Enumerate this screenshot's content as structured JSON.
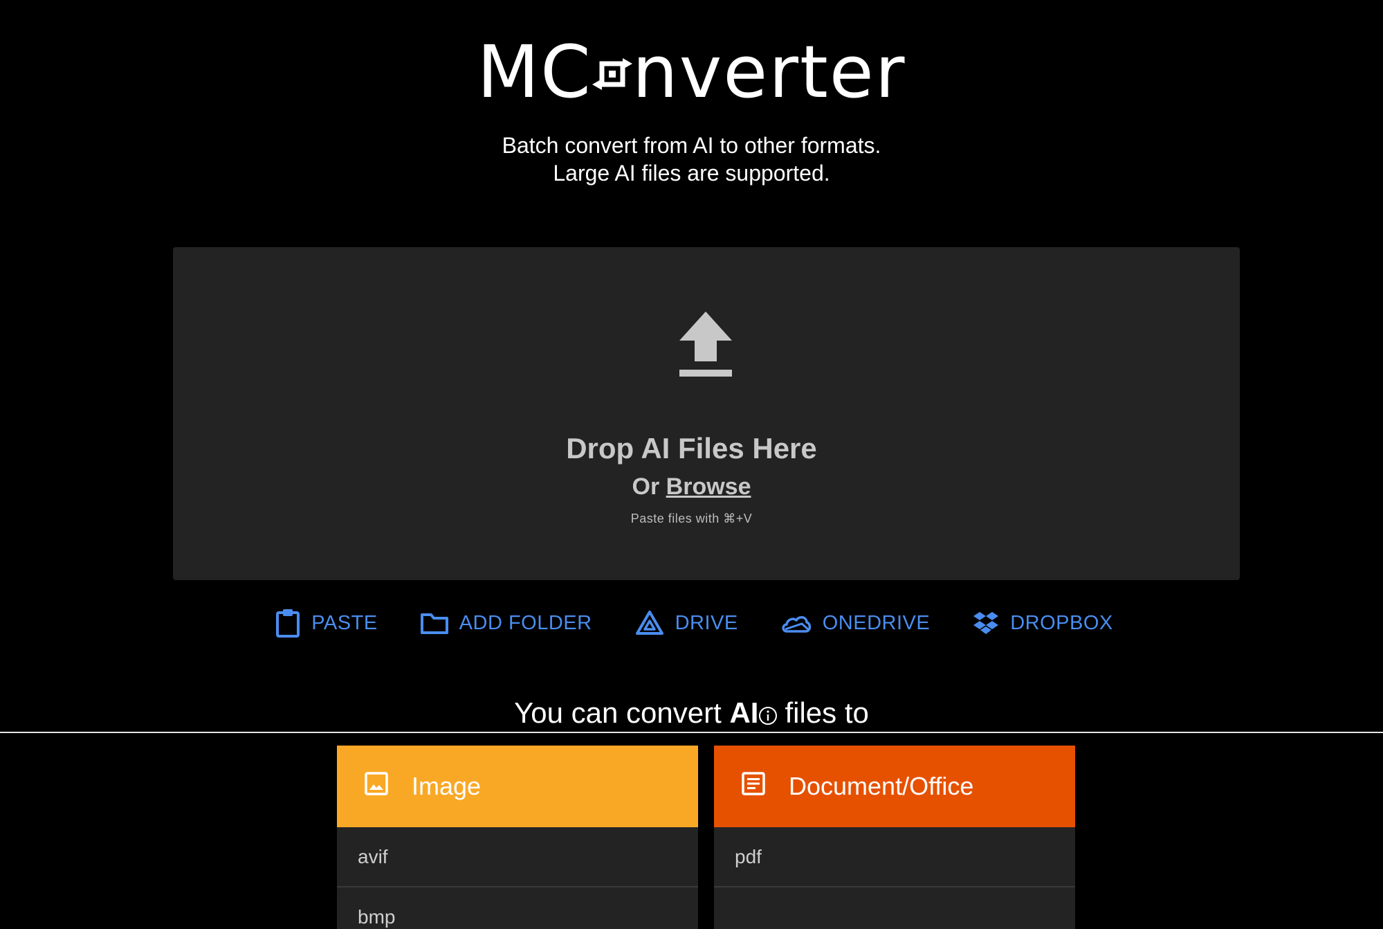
{
  "logo": {
    "before": "MC",
    "after": "nverter"
  },
  "subtitle": {
    "line1": "Batch convert from AI to other formats.",
    "line2": "Large AI files are supported."
  },
  "dropzone": {
    "title": "Drop AI Files Here",
    "or_label": "Or",
    "browse_label": "Browse",
    "paste_hint": "Paste files with ⌘+V"
  },
  "sources": [
    {
      "label": "PASTE",
      "icon": "clipboard-icon"
    },
    {
      "label": "ADD FOLDER",
      "icon": "folder-icon"
    },
    {
      "label": "DRIVE",
      "icon": "google-drive-icon"
    },
    {
      "label": "ONEDRIVE",
      "icon": "onedrive-icon"
    },
    {
      "label": "DROPBOX",
      "icon": "dropbox-icon"
    }
  ],
  "convert_heading": {
    "prefix": "You can convert",
    "format": "AI",
    "suffix": "files to"
  },
  "categories": [
    {
      "title": "Image",
      "icon": "image-icon",
      "color": "#f9a826",
      "formats": [
        "avif",
        "bmp"
      ]
    },
    {
      "title": "Document/Office",
      "icon": "document-icon",
      "color": "#e65100",
      "formats": [
        "pdf",
        ""
      ]
    }
  ],
  "colors": {
    "background": "#000000",
    "dropzone": "#232323",
    "link": "#4a8df0"
  }
}
